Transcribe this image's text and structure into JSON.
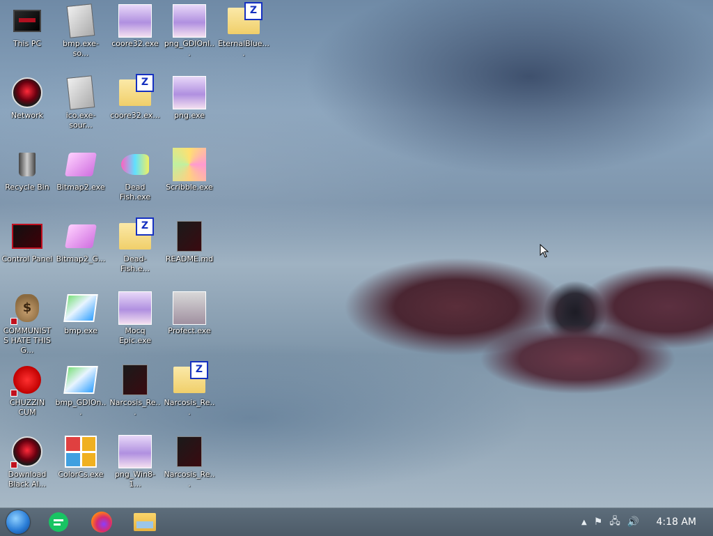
{
  "desktop": {
    "icons": [
      {
        "label": "This PC",
        "icon": "this-pc-icon"
      },
      {
        "label": "bmp.exe-so...",
        "icon": "bmp-source-icon"
      },
      {
        "label": "coore32.exe",
        "icon": "anime-girl-icon"
      },
      {
        "label": "png_GDIOnl...",
        "icon": "anime-girl-icon"
      },
      {
        "label": "EternalBlue....",
        "icon": "zip-folder-icon"
      },
      {
        "label": "Network",
        "icon": "network-icon"
      },
      {
        "label": "ico.exe-sour...",
        "icon": "ico-source-icon"
      },
      {
        "label": "coore32.ex...",
        "icon": "zip-folder-icon"
      },
      {
        "label": "png.exe",
        "icon": "anime-girl-icon"
      },
      {
        "label": "Recycle Bin",
        "icon": "recycle-bin-icon"
      },
      {
        "label": "Bitmap2.exe",
        "icon": "bitmap-icon"
      },
      {
        "label": "Dead Fish.exe",
        "icon": "dead-fish-icon"
      },
      {
        "label": "Scribble.exe",
        "icon": "scribble-icon"
      },
      {
        "label": "Control Panel",
        "icon": "control-panel-icon"
      },
      {
        "label": "Bitmap2_G...",
        "icon": "bitmap-icon"
      },
      {
        "label": "Dead-Fish.e...",
        "icon": "zip-folder-icon"
      },
      {
        "label": "README.md",
        "icon": "readme-icon"
      },
      {
        "label": "COMMUNISTS HATE THIS G...",
        "icon": "money-bag-icon"
      },
      {
        "label": "bmp.exe",
        "icon": "bmp-icon"
      },
      {
        "label": "Mocq Epic.exe",
        "icon": "anime-girl-icon"
      },
      {
        "label": "Profect.exe",
        "icon": "anime-girl-icon"
      },
      {
        "label": "CHUZZIN CUM",
        "icon": "chuzzle-icon"
      },
      {
        "label": "bmp_GDIOn...",
        "icon": "bmp-icon"
      },
      {
        "label": "Narcosis_Re...",
        "icon": "narcosis-icon"
      },
      {
        "label": "Narcosis_Re...",
        "icon": "zip-folder-icon"
      },
      {
        "label": "Download Black Al...",
        "icon": "download-icon"
      },
      {
        "label": "ColorCs.exe",
        "icon": "colorcs-icon"
      },
      {
        "label": "png_Win8-1...",
        "icon": "anime-girl-icon"
      },
      {
        "label": "Narcosis_Re...",
        "icon": "narcosis-icon"
      }
    ]
  },
  "taskbar": {
    "start_icon": "start-orb-icon",
    "pinned": [
      {
        "icon": "notes-app-icon"
      },
      {
        "icon": "firefox-icon"
      },
      {
        "icon": "file-explorer-icon"
      }
    ],
    "tray": {
      "chevron": "▲",
      "flag": "⚑",
      "network": "🖧",
      "volume": "🔊"
    },
    "clock": "4:18 AM"
  }
}
